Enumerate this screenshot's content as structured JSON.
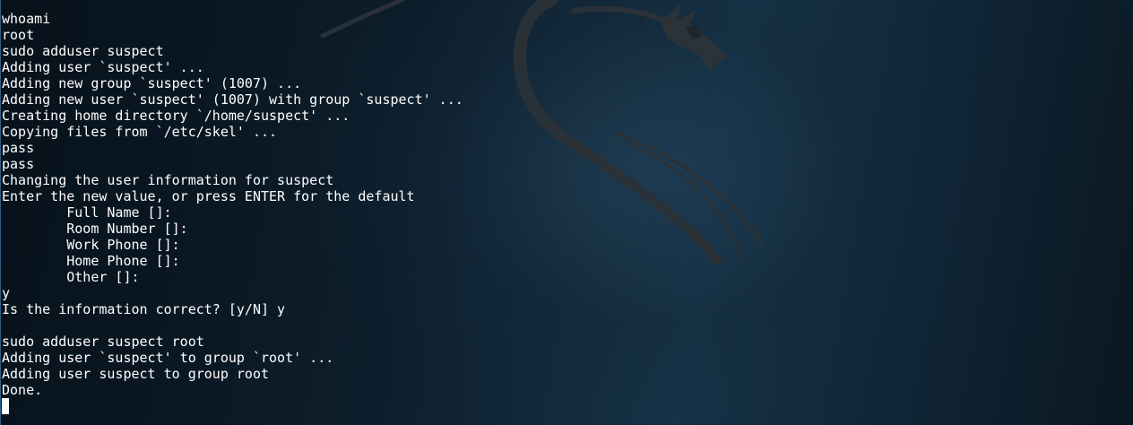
{
  "terminal": {
    "lines": [
      "whoami",
      "root",
      "sudo adduser suspect",
      "Adding user `suspect' ...",
      "Adding new group `suspect' (1007) ...",
      "Adding new user `suspect' (1007) with group `suspect' ...",
      "Creating home directory `/home/suspect' ...",
      "Copying files from `/etc/skel' ...",
      "pass",
      "pass",
      "Changing the user information for suspect",
      "Enter the new value, or press ENTER for the default",
      "        Full Name []:",
      "        Room Number []:",
      "        Work Phone []:",
      "        Home Phone []:",
      "        Other []:",
      "y",
      "Is the information correct? [y/N] y",
      "",
      "sudo adduser suspect root",
      "Adding user `suspect' to group `root' ...",
      "Adding user suspect to group root",
      "Done."
    ]
  },
  "theme": {
    "text_color": "#ffffff",
    "background_color": "#0f1e2a",
    "wallpaper_logo": "dragon-logo"
  }
}
